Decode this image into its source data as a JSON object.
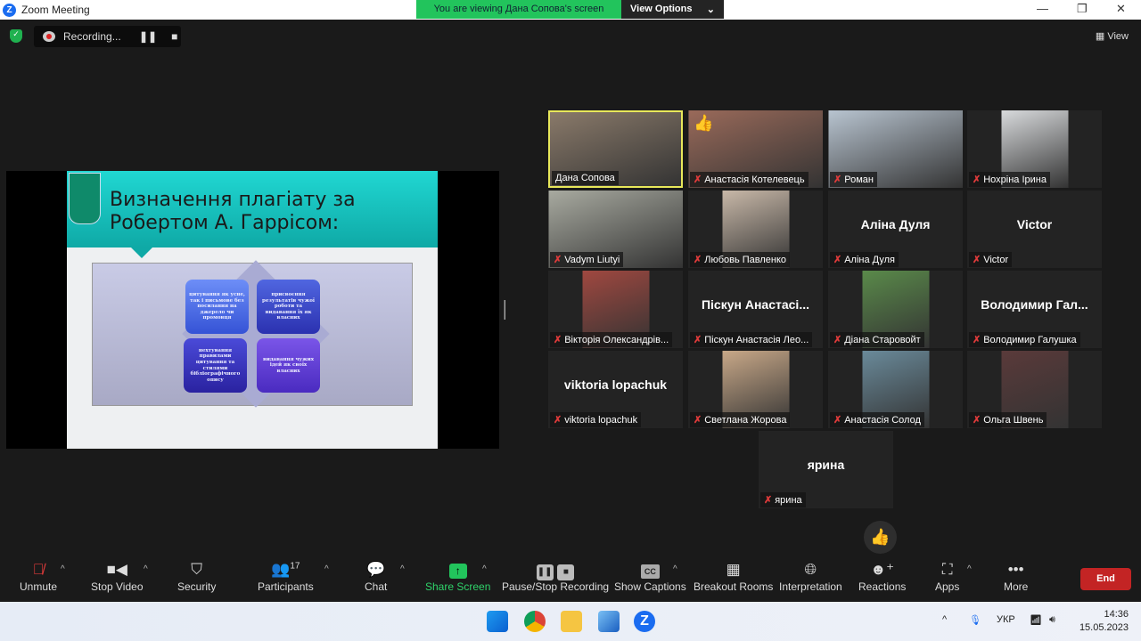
{
  "window": {
    "title": "Zoom Meeting",
    "viewing_banner": "You are viewing Дана Сопова's screen",
    "view_options": "View Options",
    "view_label": "View"
  },
  "recording": {
    "status": "Recording..."
  },
  "slide": {
    "title": "Визначення плагіату за Робертом А. Гаррісом:",
    "boxes": [
      "цитування як усне, так і письмове без посилання на джерело чи промовця",
      "присвоєння результатів чужої роботи та видавання їх як власних",
      "нехтування правилами цитування та стилями бібліографічного опису",
      "видавання чужих ідей як своїх власних"
    ]
  },
  "participants": [
    {
      "name": "Дана Сопова",
      "video": true,
      "active": true,
      "muted": false,
      "color": "#8a7a6a"
    },
    {
      "name": "Анастасія Котелевець",
      "video": true,
      "muted": true,
      "color": "#9a6a5a",
      "reaction": "👍"
    },
    {
      "name": "Роман",
      "video": true,
      "muted": true,
      "color": "#b8c4d0"
    },
    {
      "name": "Нохріна Ірина",
      "video": true,
      "muted": true,
      "color": "#d8dadc",
      "narrow": true
    },
    {
      "name": "Vadym Liutyi",
      "video": true,
      "muted": true,
      "color": "#a8aaa0"
    },
    {
      "name": "Любовь Павленко",
      "video": true,
      "muted": true,
      "color": "#c8b8a8",
      "narrow": true
    },
    {
      "name": "Аліна Дуля",
      "video": false,
      "muted": true
    },
    {
      "name": "Victor",
      "video": false,
      "muted": true
    },
    {
      "name": "Вікторія Олександрів...",
      "video": true,
      "muted": true,
      "color": "#a04840",
      "narrow": true
    },
    {
      "name": "Піскун Анастасія Лео...",
      "big": "Піскун  Анастасі...",
      "video": false,
      "muted": true
    },
    {
      "name": "Діана Старовойт",
      "video": true,
      "muted": true,
      "color": "#5a8a4a",
      "narrow": true
    },
    {
      "name": "Володимир Галушка",
      "big": "Володимир  Гал...",
      "video": false,
      "muted": true
    },
    {
      "name": "viktoria lopachuk",
      "video": false,
      "muted": true
    },
    {
      "name": "Светлана Жорова",
      "video": true,
      "muted": true,
      "color": "#c8a888",
      "narrow": true
    },
    {
      "name": "Анастасія Солод",
      "video": true,
      "muted": true,
      "color": "#6a8a9a",
      "narrow": true
    },
    {
      "name": "Ольга Швень",
      "video": true,
      "muted": true,
      "color": "#5a3a3a",
      "narrow": true
    },
    {
      "name": "ярина",
      "video": false,
      "muted": true
    }
  ],
  "toolbar": {
    "unmute": "Unmute",
    "stop_video": "Stop Video",
    "security": "Security",
    "participants": "Participants",
    "participant_count": "17",
    "chat": "Chat",
    "share_screen": "Share Screen",
    "pause_stop_recording": "Pause/Stop Recording",
    "show_captions": "Show Captions",
    "cc": "CC",
    "breakout_rooms": "Breakout Rooms",
    "interpretation": "Interpretation",
    "reactions": "Reactions",
    "apps": "Apps",
    "more": "More",
    "end": "End"
  },
  "reaction_bubble": "👍",
  "taskbar": {
    "language": "УКР",
    "time": "14:36",
    "date": "15.05.2023"
  }
}
